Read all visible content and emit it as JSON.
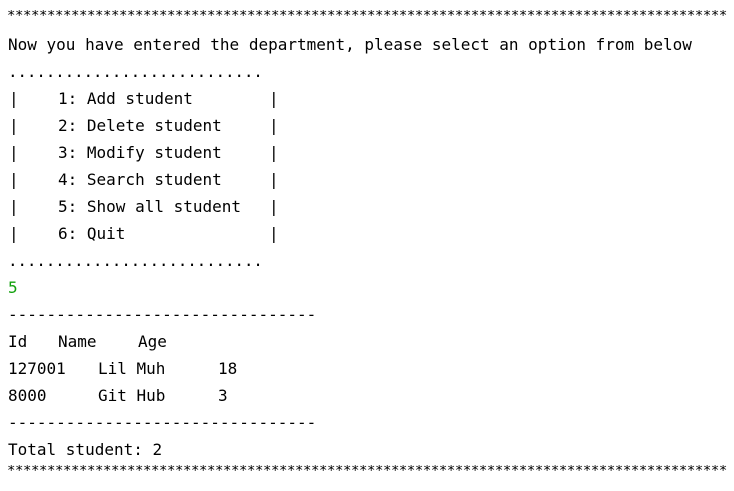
{
  "console": {
    "top_rule": "******************************************************************************************",
    "bottom_rule": "******************************************************************************************",
    "intro": "Now you have entered the department, please select an option from below",
    "dots_top": "...........................",
    "dots_bottom": "...........................",
    "menu_bar": "|",
    "menu": [
      {
        "label": "1: Add student"
      },
      {
        "label": "2: Delete student"
      },
      {
        "label": "3: Modify student"
      },
      {
        "label": "4: Search student"
      },
      {
        "label": "5: Show all student"
      },
      {
        "label": "6: Quit"
      }
    ],
    "user_input": "5",
    "dash_top": "--------------------------------",
    "dash_bottom": "--------------------------------",
    "table": {
      "headers": {
        "id": "Id",
        "name": "Name",
        "age": "Age"
      },
      "rows": [
        {
          "id": "127001",
          "name": "Lil Muh",
          "age": "18"
        },
        {
          "id": "8000",
          "name": "Git Hub",
          "age": "3"
        }
      ]
    },
    "total": "Total student: 2",
    "input_color": "#13a10e"
  }
}
